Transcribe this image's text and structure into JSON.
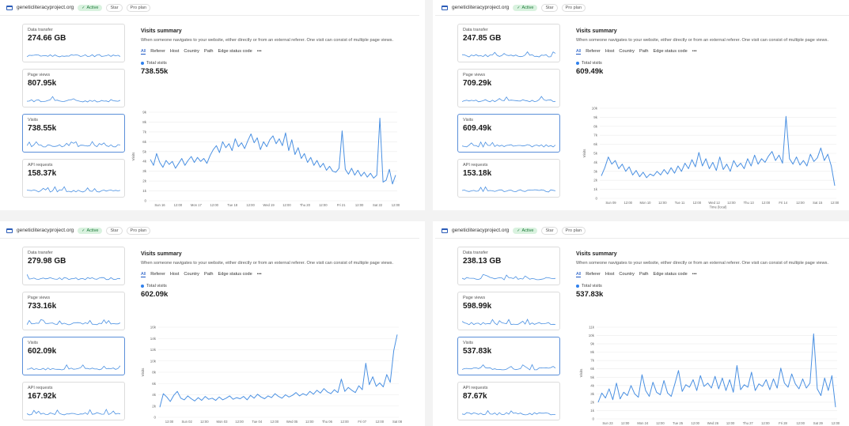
{
  "colors": {
    "line": "#4a90e2",
    "grid": "#ececec",
    "accent": "#1a56c4",
    "active_bg": "#d9f2df",
    "active_fg": "#1e7b3a"
  },
  "panels": [
    {
      "site": "geneticliteracyproject.org",
      "status": "Active",
      "star": "Star",
      "plan": "Pro plan",
      "metrics": [
        {
          "label": "Data transfer",
          "value": "274.66 GB"
        },
        {
          "label": "Page views",
          "value": "807.95k"
        },
        {
          "label": "Visits",
          "value": "738.55k"
        },
        {
          "label": "API requests",
          "value": "158.37k"
        }
      ],
      "selected_metric": 2,
      "summary_title": "Visits summary",
      "summary_desc": "When someone navigates to your website, either directly or from an external referer. One visit can consist of multiple page views.",
      "tabs": [
        "All",
        "Referer",
        "Host",
        "Country",
        "Path",
        "Edge status code",
        "•••"
      ],
      "legend_label": "Total visits",
      "legend_value": "738.55k"
    },
    {
      "site": "geneticliteracyproject.org",
      "status": "Active",
      "star": "Star",
      "plan": "Pro plan",
      "metrics": [
        {
          "label": "Data transfer",
          "value": "247.85 GB"
        },
        {
          "label": "Page views",
          "value": "709.29k"
        },
        {
          "label": "Visits",
          "value": "609.49k"
        },
        {
          "label": "API requests",
          "value": "153.18k"
        }
      ],
      "selected_metric": 2,
      "summary_title": "Visits summary",
      "summary_desc": "When someone navigates to your website, either directly or from an external referer. One visit can consist of multiple page views.",
      "tabs": [
        "All",
        "Referer",
        "Host",
        "Country",
        "Path",
        "Edge status code",
        "•••"
      ],
      "legend_label": "Total visits",
      "legend_value": "609.49k"
    },
    {
      "site": "geneticliteracyproject.org",
      "status": "Active",
      "star": "Star",
      "plan": "Pro plan",
      "metrics": [
        {
          "label": "Data transfer",
          "value": "279.98 GB"
        },
        {
          "label": "Page views",
          "value": "733.16k"
        },
        {
          "label": "Visits",
          "value": "602.09k"
        },
        {
          "label": "API requests",
          "value": "167.92k"
        }
      ],
      "selected_metric": 2,
      "summary_title": "Visits summary",
      "summary_desc": "When someone navigates to your website, either directly or from an external referer. One visit can consist of multiple page views.",
      "tabs": [
        "All",
        "Referer",
        "Host",
        "Country",
        "Path",
        "Edge status code",
        "•••"
      ],
      "legend_label": "Total visits",
      "legend_value": "602.09k"
    },
    {
      "site": "geneticliteracyproject.org",
      "status": "Active",
      "star": "Star",
      "plan": "Pro plan",
      "metrics": [
        {
          "label": "Data transfer",
          "value": "238.13 GB"
        },
        {
          "label": "Page views",
          "value": "598.99k"
        },
        {
          "label": "Visits",
          "value": "537.83k"
        },
        {
          "label": "API requests",
          "value": "87.67k"
        }
      ],
      "selected_metric": 2,
      "summary_title": "Visits summary",
      "summary_desc": "When someone navigates to your website, either directly or from an external referer. One visit can consist of multiple page views.",
      "tabs": [
        "All",
        "Referer",
        "Host",
        "Country",
        "Path",
        "Edge status code",
        "•••"
      ],
      "legend_label": "Total visits",
      "legend_value": "537.83k"
    }
  ],
  "chart_data": [
    {
      "type": "line",
      "ylabel": "Visits",
      "ylim": [
        0,
        9000
      ],
      "yticks": [
        "0",
        "1k",
        "2k",
        "3k",
        "4k",
        "5k",
        "6k",
        "7k",
        "8k",
        "9k"
      ],
      "xticks": [
        "Sun 16",
        "12:00",
        "Mon 17",
        "12:00",
        "Tue 18",
        "12:00",
        "Wed 19",
        "12:00",
        "Thu 20",
        "12:00",
        "Fri 21",
        "12:00",
        "Sat 22",
        "12:00"
      ],
      "series": [
        {
          "values": [
            4200,
            3600,
            4800,
            3900,
            3400,
            4100,
            3700,
            4000,
            3300,
            3800,
            4300,
            3600,
            4100,
            4500,
            3900,
            4400,
            4000,
            4300,
            3800,
            4600,
            5200,
            5600,
            4900,
            6000,
            5400,
            5800,
            5100,
            6300,
            5500,
            5900,
            5300,
            6100,
            6800,
            5900,
            6400,
            5200,
            6000,
            5500,
            6200,
            6600,
            5800,
            6300,
            5600,
            6900,
            5100,
            6200,
            4700,
            5400,
            4300,
            4800,
            3900,
            4400,
            3600,
            4100,
            3400,
            3800,
            3100,
            3500,
            3000,
            2900,
            3300,
            7100,
            3200,
            2700,
            3300,
            2600,
            3100,
            2500,
            2900,
            2400,
            2800,
            2300,
            2600,
            8400,
            1900,
            2100,
            3200,
            1700,
            2600
          ]
        }
      ]
    },
    {
      "type": "line",
      "ylabel": "Visits",
      "xlabel": "Time (local)",
      "ylim": [
        0,
        10000
      ],
      "yticks": [
        "0",
        "1k",
        "2k",
        "3k",
        "4k",
        "5k",
        "6k",
        "7k",
        "8k",
        "9k",
        "10k"
      ],
      "xticks": [
        "Sun 09",
        "12:00",
        "Mon 10",
        "12:00",
        "Tue 11",
        "12:00",
        "Wed 12",
        "12:00",
        "Thu 13",
        "12:00",
        "Fri 14",
        "12:00",
        "Sat 15",
        "12:00"
      ],
      "series": [
        {
          "values": [
            2500,
            3400,
            4600,
            3800,
            4200,
            3300,
            3800,
            3000,
            3500,
            2600,
            3100,
            2400,
            2900,
            2300,
            2700,
            2500,
            3000,
            2600,
            3200,
            2700,
            3400,
            2800,
            3600,
            3000,
            3900,
            3300,
            4300,
            3500,
            5100,
            3600,
            4400,
            3300,
            4000,
            3100,
            4600,
            3200,
            3800,
            3000,
            4200,
            3500,
            3900,
            3300,
            4400,
            3600,
            4800,
            3800,
            4400,
            4000,
            4700,
            5200,
            4200,
            4800,
            3900,
            9100,
            4400,
            3800,
            4600,
            3700,
            4200,
            3600,
            4900,
            4100,
            4500,
            5600,
            4200,
            4900,
            3600,
            1400
          ]
        }
      ]
    },
    {
      "type": "line",
      "ylabel": "Visits",
      "ylim": [
        0,
        16000
      ],
      "yticks": [
        "0",
        "2k",
        "4k",
        "6k",
        "8k",
        "10k",
        "12k",
        "14k",
        "16k"
      ],
      "xticks": [
        "12:00",
        "Sun 02",
        "12:00",
        "Mon 03",
        "12:00",
        "Tue 04",
        "12:00",
        "Wed 05",
        "12:00",
        "Thu 06",
        "12:00",
        "Fri 07",
        "12:00",
        "Sat 08"
      ],
      "series": [
        {
          "values": [
            1800,
            4200,
            3600,
            2800,
            3900,
            4600,
            3400,
            3100,
            3800,
            3300,
            2900,
            3500,
            3000,
            3700,
            3200,
            3400,
            3000,
            3600,
            3100,
            3400,
            3800,
            3200,
            3500,
            3300,
            3700,
            3100,
            3900,
            3400,
            4100,
            3600,
            3300,
            3800,
            3500,
            4200,
            3700,
            3400,
            4000,
            3600,
            3900,
            4400,
            3800,
            4200,
            3900,
            4600,
            4100,
            4800,
            4300,
            5100,
            4500,
            4200,
            4900,
            4400,
            6800,
            4600,
            5300,
            4800,
            4400,
            5600,
            4900,
            9600,
            5800,
            7200,
            5500,
            6100,
            5400,
            7600,
            6200,
            11800,
            14700
          ]
        }
      ]
    },
    {
      "type": "line",
      "ylabel": "Visits",
      "ylim": [
        0,
        11000
      ],
      "yticks": [
        "0",
        "1k",
        "2k",
        "3k",
        "4k",
        "5k",
        "6k",
        "7k",
        "8k",
        "9k",
        "10k",
        "11k"
      ],
      "xticks": [
        "Sun 23",
        "12:00",
        "Mon 24",
        "12:00",
        "Tue 25",
        "12:00",
        "Wed 26",
        "12:00",
        "Thu 27",
        "12:00",
        "Fri 28",
        "12:00",
        "Sat 29",
        "12:00"
      ],
      "series": [
        {
          "values": [
            2000,
            3100,
            2500,
            3600,
            2300,
            4300,
            2400,
            3200,
            2800,
            4000,
            3000,
            2600,
            5300,
            3400,
            2700,
            4400,
            3200,
            2900,
            4600,
            3100,
            2700,
            4200,
            5800,
            3300,
            4100,
            3800,
            4700,
            3400,
            5200,
            3900,
            4300,
            3700,
            5100,
            3600,
            4900,
            3400,
            4700,
            3200,
            6400,
            3500,
            4100,
            3800,
            5600,
            3400,
            4200,
            3900,
            4700,
            3500,
            4800,
            3700,
            6100,
            4300,
            3800,
            5400,
            4200,
            3600,
            4800,
            3700,
            4300,
            10200,
            3600,
            2800,
            4900,
            3400,
            5200,
            1400
          ]
        }
      ]
    }
  ]
}
